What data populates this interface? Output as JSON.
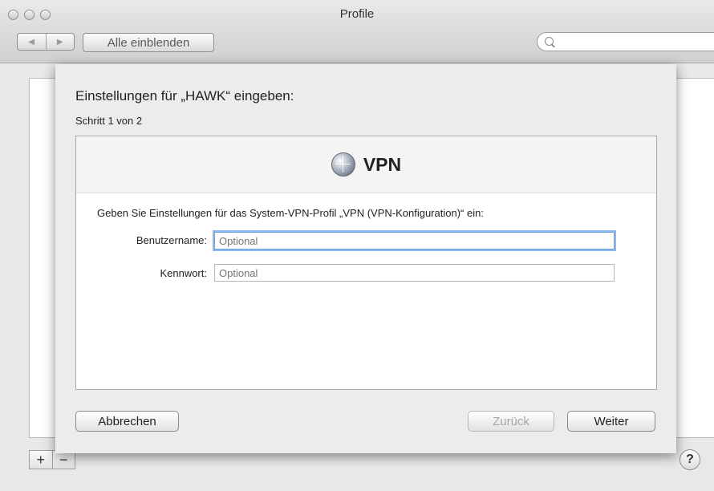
{
  "window": {
    "title": "Profile"
  },
  "toolbar": {
    "back": "◀",
    "forward": "▶",
    "show_all": "Alle einblenden",
    "search_placeholder": ""
  },
  "sheet": {
    "title": "Einstellungen für „HAWK“ eingeben:",
    "step": "Schritt 1 von 2",
    "section_title": "VPN",
    "description": "Geben Sie Einstellungen für das System-VPN-Profil „VPN (VPN-Konfiguration)“ ein:",
    "fields": [
      {
        "label": "Benutzername:",
        "value": "",
        "placeholder": "Optional"
      },
      {
        "label": "Kennwort:",
        "value": "",
        "placeholder": "Optional"
      }
    ],
    "buttons": {
      "cancel": "Abbrechen",
      "back": "Zurück",
      "next": "Weiter"
    }
  },
  "bottom": {
    "add": "+",
    "remove": "−",
    "help": "?"
  },
  "icons": {
    "section": "globe-icon",
    "search": "search-icon"
  }
}
